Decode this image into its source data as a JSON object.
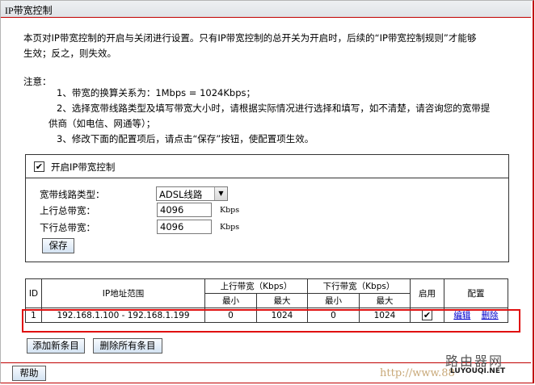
{
  "window": {
    "title": "IP带宽控制"
  },
  "intro": {
    "line1": "本页对IP带宽控制的开启与关闭进行设置。只有IP带宽控制的总开关为开启时，后续的“IP带宽控制规则”才能够",
    "line2": "生效；反之，则失效。"
  },
  "notes": {
    "heading": "注意：",
    "items": [
      "1、带宽的换算关系为：1Mbps = 1024Kbps；",
      "2、选择宽带线路类型及填写带宽大小时，请根据实际情况进行选择和填写，如不清楚，请咨询您的宽带提",
      "供商（如电信、网通等）；",
      "3、修改下面的配置项后，请点击“保存”按钮，使配置项生效。"
    ]
  },
  "control": {
    "enable_label": "开启IP带宽控制",
    "enable_checked": true,
    "line_type_label": "宽带线路类型：",
    "line_type_value": "ADSL线路",
    "up_label": "上行总带宽：",
    "up_value": "4096",
    "down_label": "下行总带宽：",
    "down_value": "4096",
    "unit": "Kbps",
    "save_label": "保存"
  },
  "table": {
    "headers": {
      "id": "ID",
      "ip_range": "IP地址范围",
      "up": "上行带宽（Kbps）",
      "down": "下行带宽（Kbps）",
      "min": "最小",
      "max": "最大",
      "enable": "启用",
      "config": "配置"
    },
    "rows": [
      {
        "id": "1",
        "ip_range": "192.168.1.100 - 192.168.1.199",
        "up_min": "0",
        "up_max": "1024",
        "down_min": "0",
        "down_max": "1024",
        "enabled": true,
        "edit": "编辑",
        "delete": "删除"
      }
    ]
  },
  "buttons": {
    "add": "添加新条目",
    "delete_all": "删除所有条目",
    "help": "帮助"
  },
  "watermark": {
    "cn": "路由器网",
    "en": "LUYOUQI.NET",
    "url": "http://www.88"
  }
}
